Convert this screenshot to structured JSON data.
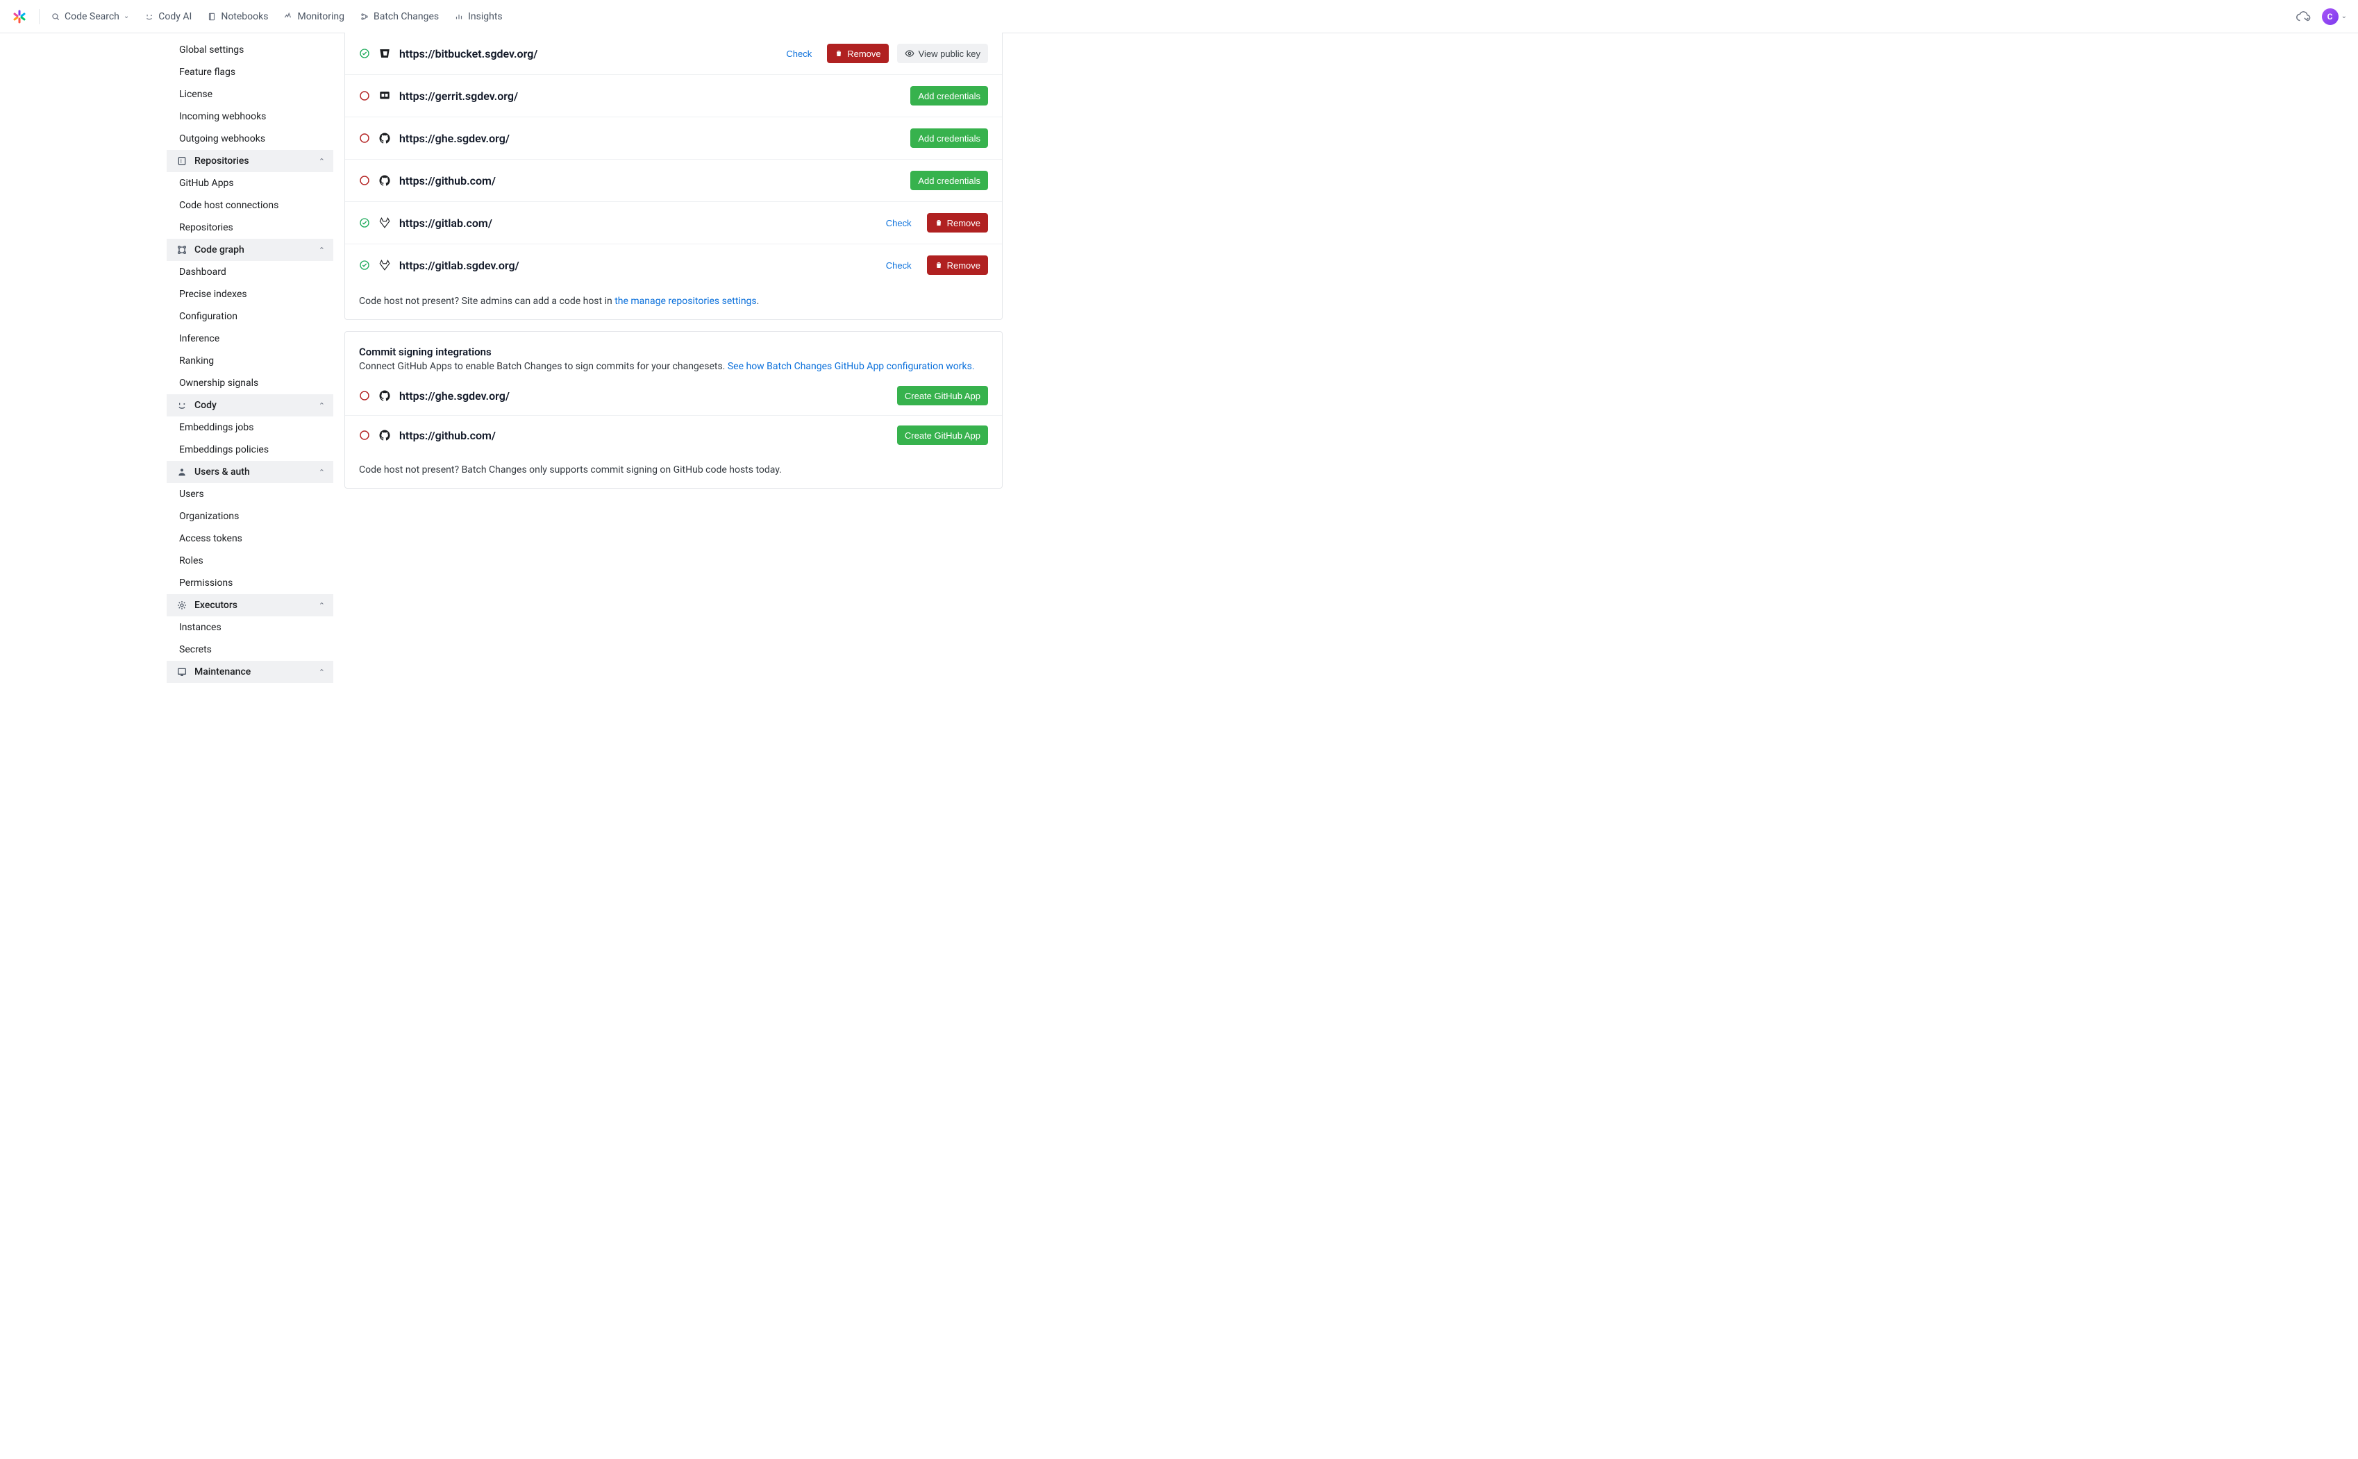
{
  "nav": {
    "items": [
      {
        "label": "Code Search",
        "icon": "search",
        "caret": true
      },
      {
        "label": "Cody AI",
        "icon": "cody"
      },
      {
        "label": "Notebooks",
        "icon": "notebook"
      },
      {
        "label": "Monitoring",
        "icon": "monitor"
      },
      {
        "label": "Batch Changes",
        "icon": "batch"
      },
      {
        "label": "Insights",
        "icon": "insights"
      }
    ],
    "avatar_initial": "C"
  },
  "sidebar": {
    "top_items": [
      "Global settings",
      "Feature flags",
      "License",
      "Incoming webhooks",
      "Outgoing webhooks"
    ],
    "groups": [
      {
        "label": "Repositories",
        "icon": "repo",
        "items": [
          "GitHub Apps",
          "Code host connections",
          "Repositories"
        ]
      },
      {
        "label": "Code graph",
        "icon": "graph",
        "items": [
          "Dashboard",
          "Precise indexes",
          "Configuration",
          "Inference",
          "Ranking",
          "Ownership signals"
        ]
      },
      {
        "label": "Cody",
        "icon": "cody",
        "items": [
          "Embeddings jobs",
          "Embeddings policies"
        ]
      },
      {
        "label": "Users & auth",
        "icon": "users",
        "items": [
          "Users",
          "Organizations",
          "Access tokens",
          "Roles",
          "Permissions"
        ]
      },
      {
        "label": "Executors",
        "icon": "exec",
        "items": [
          "Instances",
          "Secrets"
        ]
      },
      {
        "label": "Maintenance",
        "icon": "maint",
        "items": []
      }
    ]
  },
  "buttons": {
    "check": "Check",
    "remove": "Remove",
    "view_key": "View public key",
    "add_creds": "Add credentials",
    "create_app": "Create GitHub App"
  },
  "hosts": [
    {
      "status": "ok",
      "host_icon": "bitbucket",
      "url": "https://bitbucket.sgdev.org/",
      "actions": [
        "check",
        "remove",
        "view_key"
      ]
    },
    {
      "status": "no",
      "host_icon": "gerrit",
      "url": "https://gerrit.sgdev.org/",
      "actions": [
        "add_creds"
      ]
    },
    {
      "status": "no",
      "host_icon": "github",
      "url": "https://ghe.sgdev.org/",
      "actions": [
        "add_creds"
      ]
    },
    {
      "status": "no",
      "host_icon": "github",
      "url": "https://github.com/",
      "actions": [
        "add_creds"
      ]
    },
    {
      "status": "ok",
      "host_icon": "gitlab",
      "url": "https://gitlab.com/",
      "actions": [
        "check",
        "remove"
      ]
    },
    {
      "status": "ok",
      "host_icon": "gitlab",
      "url": "https://gitlab.sgdev.org/",
      "actions": [
        "check",
        "remove"
      ]
    }
  ],
  "hosts_note_pre": "Code host not present? Site admins can add a code host in ",
  "hosts_note_link": "the manage repositories settings",
  "signing": {
    "title": "Commit signing integrations",
    "sub_pre": "Connect GitHub Apps to enable Batch Changes to sign commits for your changesets. ",
    "sub_link": "See how Batch Changes GitHub App configuration works.",
    "items": [
      {
        "status": "no",
        "host_icon": "github",
        "url": "https://ghe.sgdev.org/"
      },
      {
        "status": "no",
        "host_icon": "github",
        "url": "https://github.com/"
      }
    ],
    "note": "Code host not present? Batch Changes only supports commit signing on GitHub code hosts today."
  }
}
